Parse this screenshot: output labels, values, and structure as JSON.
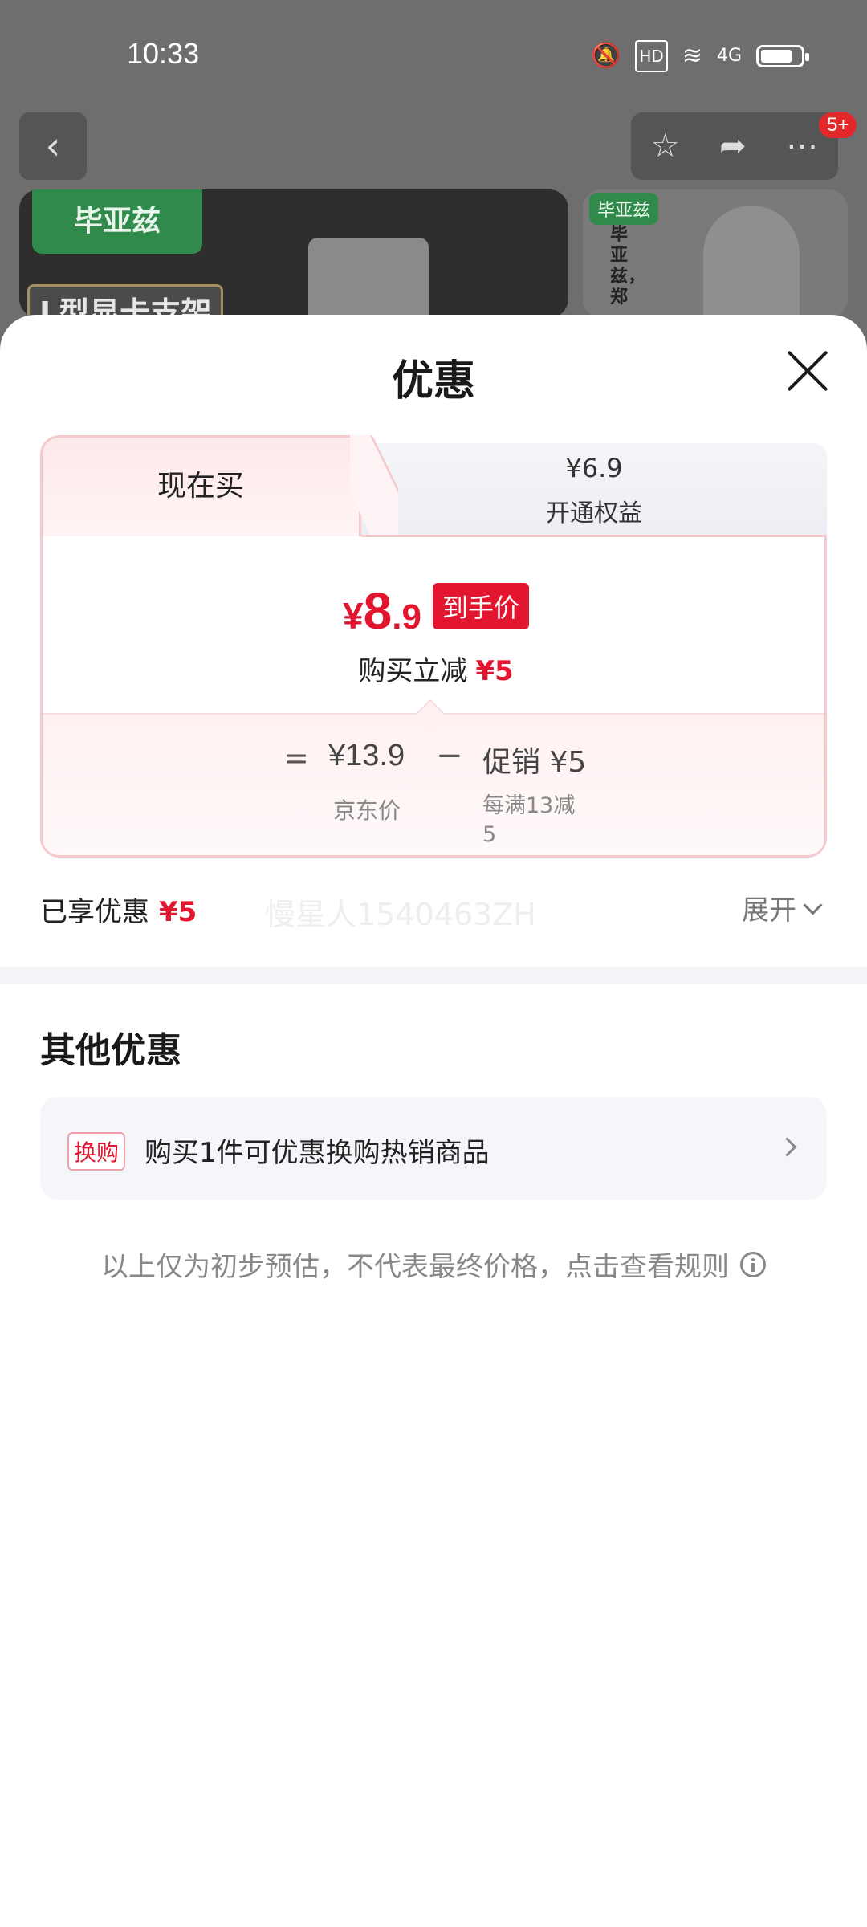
{
  "status_bar": {
    "time": "10:33",
    "icons": [
      "bell-off-icon",
      "hd-icon",
      "wifi-icon",
      "signal-4g-icon",
      "battery-icon"
    ],
    "network_label": "4G",
    "hd_label": "HD"
  },
  "product_header": {
    "badge_count": "5+",
    "banner_left_logo": "毕亚兹",
    "banner_left_headline": "L型显卡支架",
    "banner_right_logo": "毕亚兹",
    "banner_right_vertical_text": "毕亚兹，郑"
  },
  "sheet": {
    "title": "优惠",
    "tabs": [
      {
        "label": "现在买"
      },
      {
        "price": "¥6.9",
        "label": "开通权益"
      }
    ],
    "final_price": {
      "yen": "¥",
      "integer": "8",
      "decimal": ".9",
      "tag": "到手价"
    },
    "instant_reduce": {
      "label": "购买立减",
      "amount": "¥5"
    },
    "calculation": {
      "equals": "=",
      "jd_price": "¥13.9",
      "jd_label": "京东价",
      "minus": "−",
      "promo": "促销 ¥5",
      "promo_desc": "每满13减5"
    },
    "enjoyed": {
      "label": "已享优惠",
      "amount": "¥5"
    },
    "watermark": "慢星人1540463ZH",
    "expand_label": "展开",
    "other_offers_title": "其他优惠",
    "other_offers": [
      {
        "tag": "换购",
        "text": "购买1件可优惠换购热销商品"
      }
    ],
    "disclaimer": "以上仅为初步预估，不代表最终价格，点击查看规则"
  },
  "colors": {
    "accent_red": "#e3162f",
    "card_border": "#f6c9ce",
    "overlay": "#6e6e6e"
  }
}
